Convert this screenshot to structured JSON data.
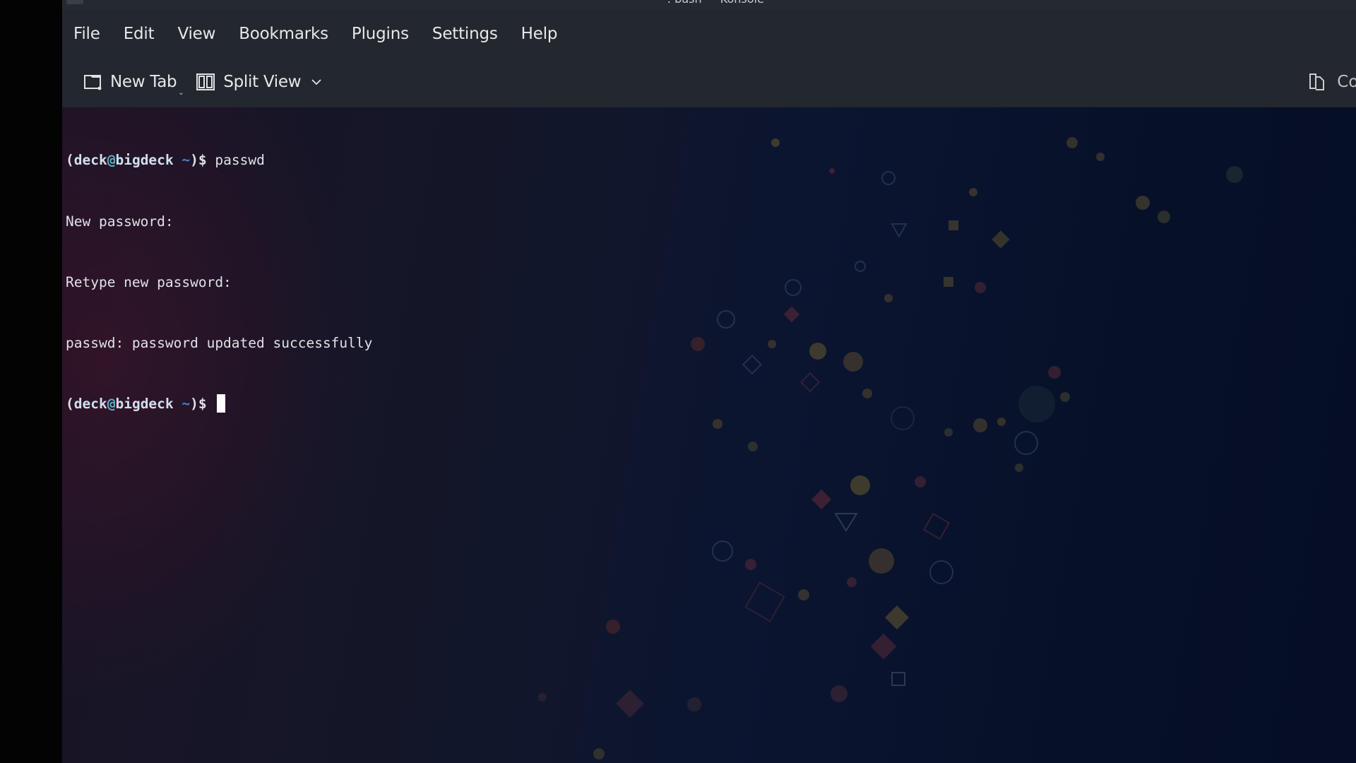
{
  "window": {
    "title": "~ : bash — Konsole"
  },
  "menubar": {
    "items": [
      {
        "label": "File"
      },
      {
        "label": "Edit"
      },
      {
        "label": "View"
      },
      {
        "label": "Bookmarks"
      },
      {
        "label": "Plugins"
      },
      {
        "label": "Settings"
      },
      {
        "label": "Help"
      }
    ]
  },
  "toolbar": {
    "new_tab": {
      "label": "New Tab",
      "icon": "new-tab-icon"
    },
    "split_view": {
      "label": "Split View",
      "icon": "split-view-icon",
      "dropdown_icon": "chevron-down-icon"
    },
    "copy": {
      "label": "Cop",
      "icon": "copy-icon"
    }
  },
  "terminal": {
    "prompt": {
      "open": "(",
      "user": "deck",
      "at": "@",
      "host": "bigdeck",
      "cwd": "~",
      "close": ")$"
    },
    "lines": [
      {
        "type": "prompt",
        "command": "passwd"
      },
      {
        "type": "output",
        "text": "New password:"
      },
      {
        "type": "output",
        "text": "Retype new password:"
      },
      {
        "type": "output",
        "text": "passwd: password updated successfully"
      },
      {
        "type": "prompt",
        "command": ""
      }
    ]
  },
  "colors": {
    "window_bg": "#23272e",
    "terminal_text": "#dfe2e6",
    "prompt_user": "#cfe0ee",
    "prompt_at": "#5fb3c7",
    "prompt_tilde": "#3d86d8",
    "cursor": "#ffffff"
  }
}
